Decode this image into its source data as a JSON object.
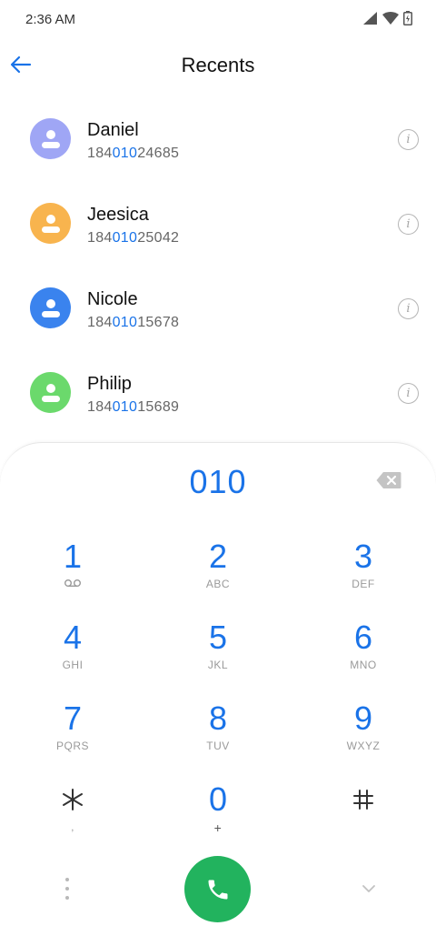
{
  "status_bar": {
    "time": "2:36 AM",
    "icons": [
      "signal-icon",
      "wifi-icon",
      "battery-charging-icon"
    ]
  },
  "header": {
    "title": "Recents",
    "back_icon": "arrow-left-icon"
  },
  "contacts": [
    {
      "name": "Daniel",
      "number_prefix": "184",
      "number_match": "010",
      "number_suffix": "24685",
      "avatar_color": "#9fa6f5"
    },
    {
      "name": "Jeesica",
      "number_prefix": "184",
      "number_match": "010",
      "number_suffix": "25042",
      "avatar_color": "#f8b44e"
    },
    {
      "name": "Nicole",
      "number_prefix": "184",
      "number_match": "010",
      "number_suffix": "15678",
      "avatar_color": "#3a83ee"
    },
    {
      "name": "Philip",
      "number_prefix": "184",
      "number_match": "010",
      "number_suffix": "15689",
      "avatar_color": "#6bd96c"
    }
  ],
  "info_glyph": "i",
  "dialpad": {
    "dialed_number": "010",
    "keys": [
      {
        "digit": "1",
        "letters": "",
        "icon": "voicemail-icon"
      },
      {
        "digit": "2",
        "letters": "ABC"
      },
      {
        "digit": "3",
        "letters": "DEF"
      },
      {
        "digit": "4",
        "letters": "GHI"
      },
      {
        "digit": "5",
        "letters": "JKL"
      },
      {
        "digit": "6",
        "letters": "MNO"
      },
      {
        "digit": "7",
        "letters": "PQRS"
      },
      {
        "digit": "8",
        "letters": "TUV"
      },
      {
        "digit": "9",
        "letters": "WXYZ"
      },
      {
        "digit": "*",
        "letters": ","
      },
      {
        "digit": "0",
        "letters": "+"
      },
      {
        "digit": "#",
        "letters": ""
      }
    ],
    "call_icon": "phone-icon"
  },
  "colors": {
    "accent": "#1a73e8",
    "call_button": "#22b35e"
  }
}
